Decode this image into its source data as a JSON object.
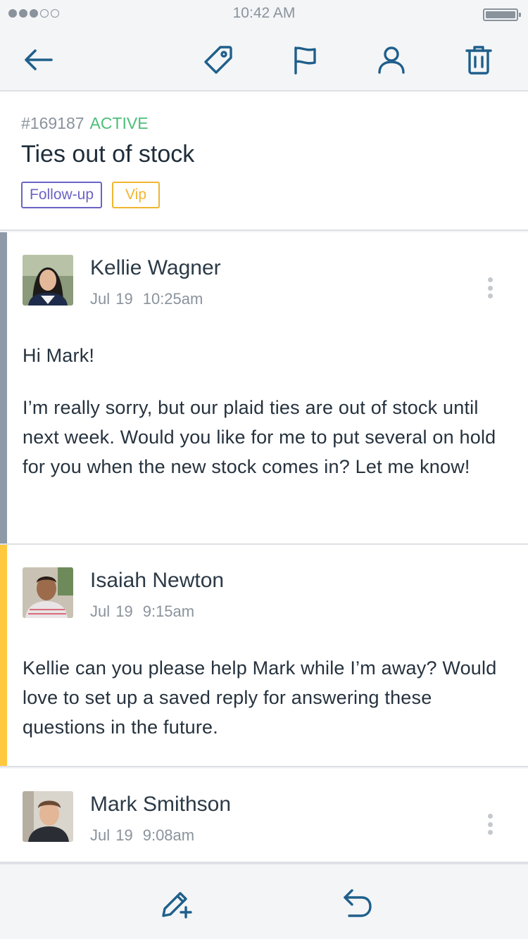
{
  "status_bar": {
    "time": "10:42 AM",
    "signal_filled": 3,
    "signal_total": 5
  },
  "toolbar": {
    "icons": [
      "back-arrow-icon",
      "tag-icon",
      "flag-icon",
      "user-icon",
      "trash-icon"
    ],
    "accent_color": "#1f5f8b"
  },
  "ticket": {
    "id": "#169187",
    "status": "ACTIVE",
    "title": "Ties out of stock",
    "tags": [
      {
        "label": "Follow-up",
        "color": "#6a64c4"
      },
      {
        "label": "Vip",
        "color": "#f1b630"
      }
    ]
  },
  "messages": [
    {
      "author": "Kellie Wagner",
      "date": "Jul 19",
      "time": "10:25am",
      "bar_color": "#8f9aa8",
      "body": [
        "Hi Mark!",
        "I’m really sorry, but our plaid ties are out of stock until next week. Would you like for me to put several on hold for you when the new stock comes in? Let me know!"
      ]
    },
    {
      "author": "Isaiah Newton",
      "date": "Jul 19",
      "time": "9:15am",
      "bar_color": "#ffc83d",
      "body": [
        "Kellie can you please help Mark while I’m away? Would love to set up a saved reply for answering these questions in the future."
      ]
    },
    {
      "author": "Mark Smithson",
      "date": "Jul 19",
      "time": "9:08am",
      "bar_color": "#ffffff",
      "body": []
    }
  ],
  "bottom_bar": {
    "icons": [
      "compose-icon",
      "reply-icon"
    ]
  }
}
